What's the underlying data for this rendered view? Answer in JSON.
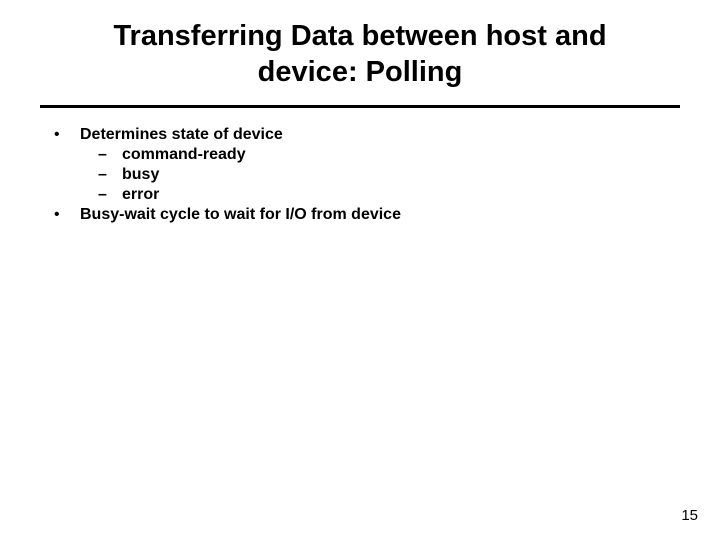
{
  "title": "Transferring Data between host and device: Polling",
  "bullets": [
    {
      "text": "Determines state of device",
      "subs": [
        "command-ready",
        "busy",
        "error"
      ]
    },
    {
      "text": "Busy-wait cycle to wait for I/O from device",
      "subs": []
    }
  ],
  "pageNumber": "15"
}
